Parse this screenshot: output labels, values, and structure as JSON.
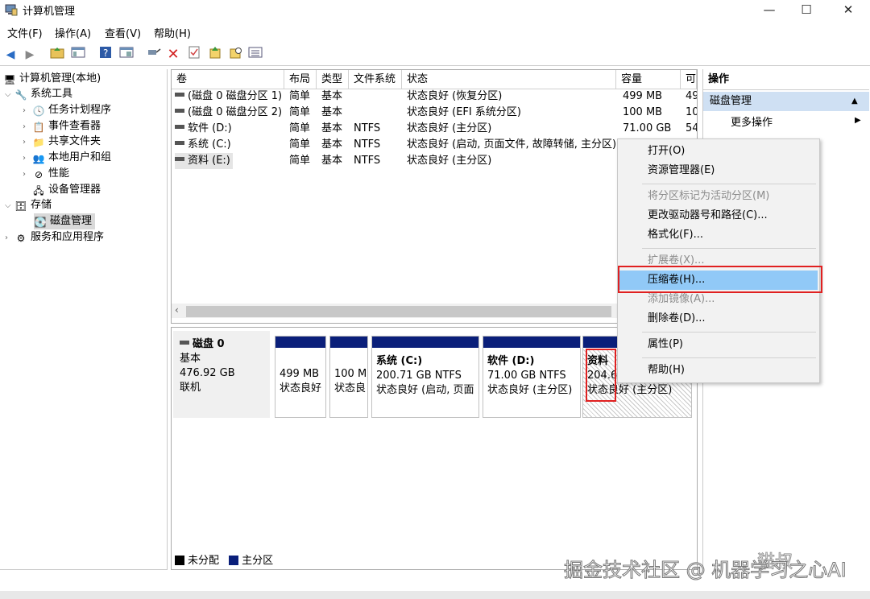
{
  "window": {
    "title": "计算机管理"
  },
  "menu": [
    "文件(F)",
    "操作(A)",
    "查看(V)",
    "帮助(H)"
  ],
  "tree": [
    {
      "label": "计算机管理(本地)",
      "icon": "computer-icon",
      "level": 0,
      "exp": ""
    },
    {
      "label": "系统工具",
      "icon": "tools-icon",
      "level": 1,
      "exp": "v"
    },
    {
      "label": "任务计划程序",
      "icon": "clock-icon",
      "level": 2,
      "exp": ">"
    },
    {
      "label": "事件查看器",
      "icon": "event-icon",
      "level": 2,
      "exp": ">"
    },
    {
      "label": "共享文件夹",
      "icon": "folder-icon",
      "level": 2,
      "exp": ">"
    },
    {
      "label": "本地用户和组",
      "icon": "users-icon",
      "level": 2,
      "exp": ">"
    },
    {
      "label": "性能",
      "icon": "perf-icon",
      "level": 2,
      "exp": ">"
    },
    {
      "label": "设备管理器",
      "icon": "device-icon",
      "level": 2,
      "exp": ""
    },
    {
      "label": "存储",
      "icon": "storage-icon",
      "level": 1,
      "exp": "v"
    },
    {
      "label": "磁盘管理",
      "icon": "disk-icon",
      "level": 2,
      "exp": "",
      "selected": true
    },
    {
      "label": "服务和应用程序",
      "icon": "services-icon",
      "level": 1,
      "exp": ">"
    }
  ],
  "volumes": {
    "columns": [
      "卷",
      "布局",
      "类型",
      "文件系统",
      "状态",
      "容量",
      "可"
    ],
    "rows": [
      [
        "(磁盘 0 磁盘分区 1)",
        "简单",
        "基本",
        "",
        "状态良好 (恢复分区)",
        "499 MB",
        "49"
      ],
      [
        "(磁盘 0 磁盘分区 2)",
        "简单",
        "基本",
        "",
        "状态良好 (EFI 系统分区)",
        "100 MB",
        "10"
      ],
      [
        "软件 (D:)",
        "简单",
        "基本",
        "NTFS",
        "状态良好 (主分区)",
        "71.00 GB",
        "54"
      ],
      [
        "系统 (C:)",
        "简单",
        "基本",
        "NTFS",
        "状态良好 (启动, 页面文件, 故障转储, 主分区)",
        "",
        ""
      ],
      [
        "资料 (E:)",
        "简单",
        "基本",
        "NTFS",
        "状态良好 (主分区)",
        "",
        ""
      ]
    ]
  },
  "disk": {
    "name": "磁盘 0",
    "type": "基本",
    "size": "476.92 GB",
    "status": "联机",
    "partitions": [
      {
        "title": "",
        "size": "499 MB",
        "status": "状态良好"
      },
      {
        "title": "",
        "size": "100 M",
        "status": "状态良"
      },
      {
        "title": "系统 (C:)",
        "size": "200.71 GB NTFS",
        "status": "状态良好 (启动, 页面"
      },
      {
        "title": "软件 (D:)",
        "size": "71.00 GB NTFS",
        "status": "状态良好 (主分区)"
      },
      {
        "title": "资料",
        "size": "204.6",
        "status": "状态良好 (主分区)"
      }
    ]
  },
  "legend": [
    {
      "label": "未分配",
      "color": "#000000"
    },
    {
      "label": "主分区",
      "color": "#0a1f7a"
    }
  ],
  "actions": {
    "header": "操作",
    "section": "磁盘管理",
    "more": "更多操作"
  },
  "context_menu": [
    {
      "label": "打开(O)",
      "disabled": false
    },
    {
      "label": "资源管理器(E)",
      "disabled": false
    },
    {
      "label": "将分区标记为活动分区(M)",
      "disabled": true
    },
    {
      "label": "更改驱动器号和路径(C)...",
      "disabled": false
    },
    {
      "label": "格式化(F)...",
      "disabled": false
    },
    {
      "label": "扩展卷(X)...",
      "disabled": true
    },
    {
      "label": "压缩卷(H)...",
      "disabled": false,
      "highlighted": true
    },
    {
      "label": "添加镜像(A)...",
      "disabled": true
    },
    {
      "label": "删除卷(D)...",
      "disabled": false
    },
    {
      "label": "属性(P)",
      "disabled": false
    },
    {
      "label": "帮助(H)",
      "disabled": false
    }
  ],
  "watermark": "掘金技术社区 @ 机器学习之心AI",
  "watermark2": "猫叔"
}
